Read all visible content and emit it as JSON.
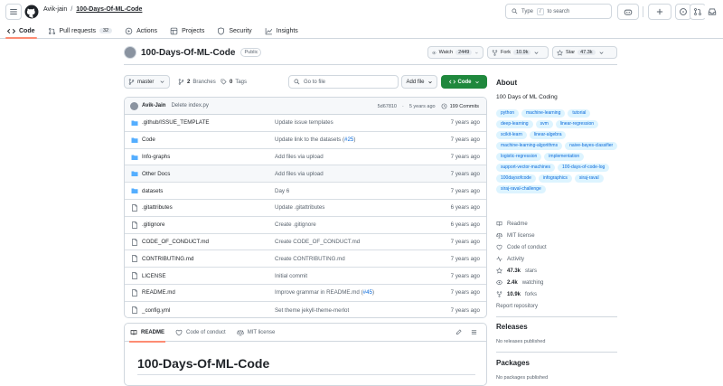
{
  "header": {
    "owner": "Avik-jain",
    "separator": "/",
    "repo": "100-Days-Of-ML-Code",
    "search_placeholder": "Type / to search",
    "search_prefix": "Type",
    "search_key": "/",
    "search_suffix": "to search"
  },
  "tabs": [
    {
      "label": "Code",
      "icon": "code-icon"
    },
    {
      "label": "Pull requests",
      "count": "32",
      "icon": "pull-request-icon"
    },
    {
      "label": "Actions",
      "icon": "play-icon"
    },
    {
      "label": "Projects",
      "icon": "table-icon"
    },
    {
      "label": "Security",
      "icon": "shield-icon"
    },
    {
      "label": "Insights",
      "icon": "graph-icon"
    }
  ],
  "repo": {
    "name": "100-Days-Of-ML-Code",
    "visibility": "Public",
    "watch_label": "Watch",
    "watch_count": "2449",
    "fork_label": "Fork",
    "fork_count": "10.9k",
    "star_label": "Star",
    "star_count": "47.3k"
  },
  "branchbar": {
    "branch": "master",
    "branches_count": "2",
    "branches_label": "Branches",
    "tags_count": "0",
    "tags_label": "Tags",
    "go_to_file": "Go to file",
    "add_file": "Add file",
    "code": "Code"
  },
  "commit": {
    "author": "Avik-Jain",
    "message": "Delete index.py",
    "hash": "5d67810",
    "time": "5 years ago",
    "commits": "199 Commits"
  },
  "files": [
    {
      "name": ".github/ISSUE_TEMPLATE",
      "type": "folder",
      "message": "Update issue templates",
      "time": "7 years ago"
    },
    {
      "name": "Code",
      "type": "folder",
      "message": "Update link to the datasets (",
      "link": "#25",
      "suffix": ")",
      "time": "7 years ago"
    },
    {
      "name": "Info-graphs",
      "type": "folder",
      "message": "Add files via upload",
      "time": "7 years ago"
    },
    {
      "name": "Other Docs",
      "type": "folder",
      "message": "Add files via upload",
      "time": "7 years ago"
    },
    {
      "name": "datasets",
      "type": "folder",
      "message": "Day 6",
      "time": "7 years ago"
    },
    {
      "name": ".gitattributes",
      "type": "file",
      "message": "Update .gitattributes",
      "time": "6 years ago"
    },
    {
      "name": ".gitignore",
      "type": "file",
      "message": "Create .gitignore",
      "time": "6 years ago"
    },
    {
      "name": "CODE_OF_CONDUCT.md",
      "type": "file",
      "message": "Create CODE_OF_CONDUCT.md",
      "time": "7 years ago"
    },
    {
      "name": "CONTRIBUTING.md",
      "type": "file",
      "message": "Create CONTRIBUTING.md",
      "time": "7 years ago"
    },
    {
      "name": "LICENSE",
      "type": "file",
      "message": "Initial commit",
      "time": "7 years ago"
    },
    {
      "name": "README.md",
      "type": "file",
      "message": "Improve grammar in README.md (",
      "link": "#45",
      "suffix": ")",
      "time": "7 years ago"
    },
    {
      "name": "_config.yml",
      "type": "file",
      "message": "Set theme jekyll-theme-merlot",
      "time": "7 years ago"
    }
  ],
  "readme_tabs": [
    {
      "label": "README",
      "icon": "book-icon"
    },
    {
      "label": "Code of conduct",
      "icon": "heart-icon"
    },
    {
      "label": "MIT license",
      "icon": "law-icon"
    }
  ],
  "readme_title": "100-Days-Of-ML-Code",
  "about": {
    "title": "About",
    "description": "100 Days of ML Coding",
    "topics": [
      "python",
      "machine-learning",
      "tutorial",
      "deep-learning",
      "svm",
      "linear-regression",
      "scikit-learn",
      "linear-algebra",
      "machine-learning-algorithms",
      "naive-bayes-classifier",
      "logistic-regression",
      "implementation",
      "support-vector-machines",
      "100-days-of-code-log",
      "100daysofcode",
      "infographics",
      "siraj-raval",
      "siraj-raval-challenge"
    ],
    "links": [
      {
        "icon": "book-icon",
        "label": "Readme"
      },
      {
        "icon": "law-icon",
        "label": "MIT license"
      },
      {
        "icon": "heart-icon",
        "label": "Code of conduct"
      },
      {
        "icon": "pulse-icon",
        "label": "Activity"
      },
      {
        "icon": "star-icon",
        "value": "47.3k",
        "label": "stars"
      },
      {
        "icon": "eye-icon",
        "value": "2.4k",
        "label": "watching"
      },
      {
        "icon": "fork-icon",
        "value": "10.9k",
        "label": "forks"
      }
    ],
    "report": "Report repository"
  },
  "releases": {
    "title": "Releases",
    "text": "No releases published"
  },
  "packages": {
    "title": "Packages",
    "text": "No packages published"
  },
  "colors": {
    "accent": "#0969da",
    "green": "#1f883d",
    "folder": "#54aeff",
    "tab_underline": "#fd8c73"
  }
}
